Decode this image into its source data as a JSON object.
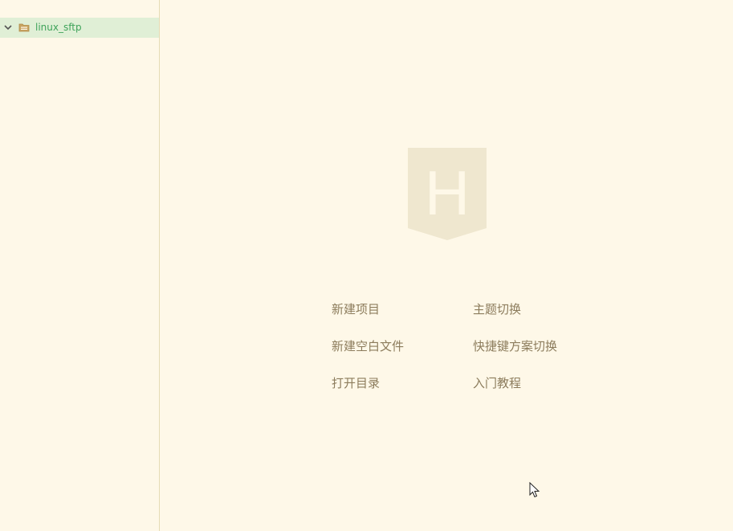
{
  "sidebar": {
    "tree": [
      {
        "label": "linux_sftp",
        "expanded": true,
        "icon": "folder-icon",
        "selected": true
      }
    ]
  },
  "welcome": {
    "logo_letter": "H",
    "actions_left": [
      {
        "label": "新建项目"
      },
      {
        "label": "新建空白文件"
      },
      {
        "label": "打开目录"
      }
    ],
    "actions_right": [
      {
        "label": "主题切换"
      },
      {
        "label": "快捷键方案切换"
      },
      {
        "label": "入门教程"
      }
    ]
  },
  "colors": {
    "background": "#fef8e8",
    "selection": "#e0efd6",
    "tree_label": "#3fa35a",
    "action_text": "#8c7c5c",
    "logo": "#efe7cf"
  }
}
